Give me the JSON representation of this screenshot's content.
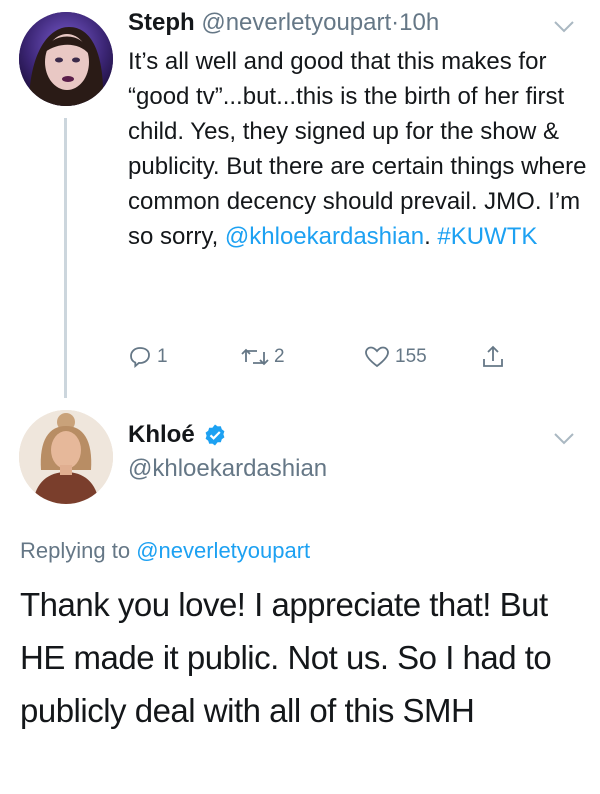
{
  "tweet1": {
    "name": "Steph",
    "handle": "@neverletyoupart",
    "separator": "·",
    "time": "10h",
    "text_plain": "It’s all well and good that this makes for “good tv”...but...this is the birth of her first child. Yes, they signed up for the show & publicity. But there are certain things where common decency should prevail. JMO. I’m so sorry, ",
    "mention": "@khloekardashian",
    "mid_text": ". ",
    "hashtag": "#KUWTK",
    "reply_count": "1",
    "retweet_count": "2",
    "like_count": "155"
  },
  "tweet2": {
    "name": "Khloé",
    "handle": "@khloekardashian",
    "replying_prefix": "Replying to ",
    "replying_handle": "@neverletyoupart",
    "text": "Thank you love! I appreciate that! But HE made it public. Not us. So I had to publicly deal with all of this SMH"
  },
  "icons": {
    "reply": "reply-icon",
    "retweet": "retweet-icon",
    "like": "heart-icon",
    "share": "share-icon",
    "verified": "verified-badge-icon",
    "menu": "chevron-down-icon"
  },
  "colors": {
    "link": "#1da1f2",
    "secondary_text": "#657786",
    "primary_text": "#14171a",
    "thread_line": "#ccd6dd"
  }
}
